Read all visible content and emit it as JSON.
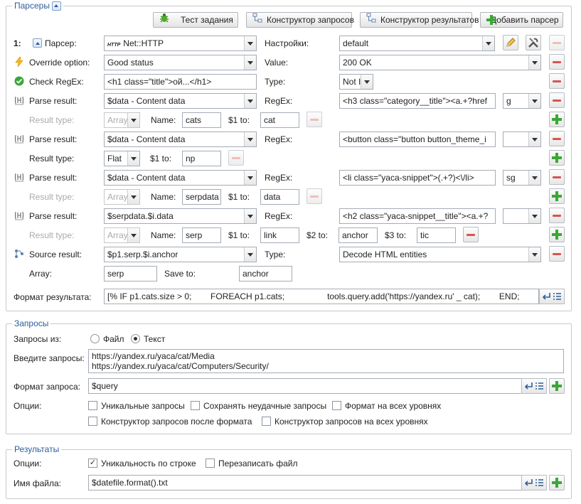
{
  "parsers": {
    "legend": "Парсеры",
    "toolbar": {
      "test": "Тест задания",
      "query_builder": "Конструктор запросов",
      "result_builder": "Конструктор результатов",
      "add_parser": "Добавить парсер"
    },
    "index": "1:",
    "parser_label": "Парсер:",
    "parser_value": "Net::HTTP",
    "settings_label": "Настройки:",
    "settings_value": "default",
    "override_label": "Override option:",
    "override_value": "Good status",
    "value_label": "Value:",
    "value_value": "200 OK",
    "check_label": "Check RegEx:",
    "check_value": "<h1 class=\"title\">ой...</h1>",
    "type_label": "Type:",
    "check_type": "Not I",
    "parse_label": "Parse result:",
    "regex_label": "RegEx:",
    "result_type_label": "Result type:",
    "name_label": "Name:",
    "one_to_label": "$1 to:",
    "two_to_label": "$2 to:",
    "three_to_label": "$3 to:",
    "p1_source": "$data - Content data",
    "p1_regex": "<h3 class=\"category__title\"><a.+?href",
    "p1_flags": "g",
    "p1_rtype": "Array",
    "p1_name": "cats",
    "p1_to": "cat",
    "p2_source": "$data - Content data",
    "p2_regex": "<button class=\"button button_theme_i",
    "p2_flags": "",
    "p2_rtype": "Flat",
    "p2_to": "np",
    "p3_source": "$data - Content data",
    "p3_regex": "<li class=\"yaca-snippet\">(.+?)<\\/li>",
    "p3_flags": "sg",
    "p3_rtype": "Array",
    "p3_name": "serpdata",
    "p3_to": "data",
    "p4_source": "$serpdata.$i.data",
    "p4_regex": "<h2 class=\"yaca-snippet__title\"><a.+?",
    "p4_flags": "",
    "p4_rtype": "Array",
    "p4_name": "serp",
    "p4_to1": "link",
    "p4_to2": "anchor",
    "p4_to3": "tic",
    "source_label": "Source result:",
    "source_value": "$p1.serp.$i.anchor",
    "source_type": "Decode HTML entities",
    "array_label": "Array:",
    "array_value": "serp",
    "save_to_label": "Save to:",
    "save_to_value": "anchor",
    "format_label": "Формат результата:",
    "format_value": "[% IF p1.cats.size > 0;        FOREACH p1.cats;                  tools.query.add('https://yandex.ru' _ cat);        END;"
  },
  "queries": {
    "legend": "Запросы",
    "from_label": "Запросы из:",
    "file_option": "Файл",
    "text_option": "Текст",
    "enter_label": "Введите запросы:",
    "query_lines": [
      "https://yandex.ru/yaca/cat/Media",
      "https://yandex.ru/yaca/cat/Computers/Security/"
    ],
    "format_label": "Формат запроса:",
    "format_value": "$query",
    "options_label": "Опции:",
    "opt_unique": "Уникальные запросы",
    "opt_save_failed": "Сохранять неудачные запросы",
    "opt_format_all": "Формат на всех уровнях",
    "opt_builder_after": "Конструктор запросов после формата",
    "opt_builder_all": "Конструктор запросов на всех уровнях"
  },
  "results": {
    "legend": "Результаты",
    "options_label": "Опции:",
    "opt_unique_line": "Уникальность по строке",
    "opt_overwrite": "Перезаписать файл",
    "filename_label": "Имя файла:",
    "filename_value": "$datefile.format().txt"
  },
  "colors": {
    "accent": "#2b5d9c",
    "plus": "#39a935",
    "minus": "#d9534f"
  }
}
